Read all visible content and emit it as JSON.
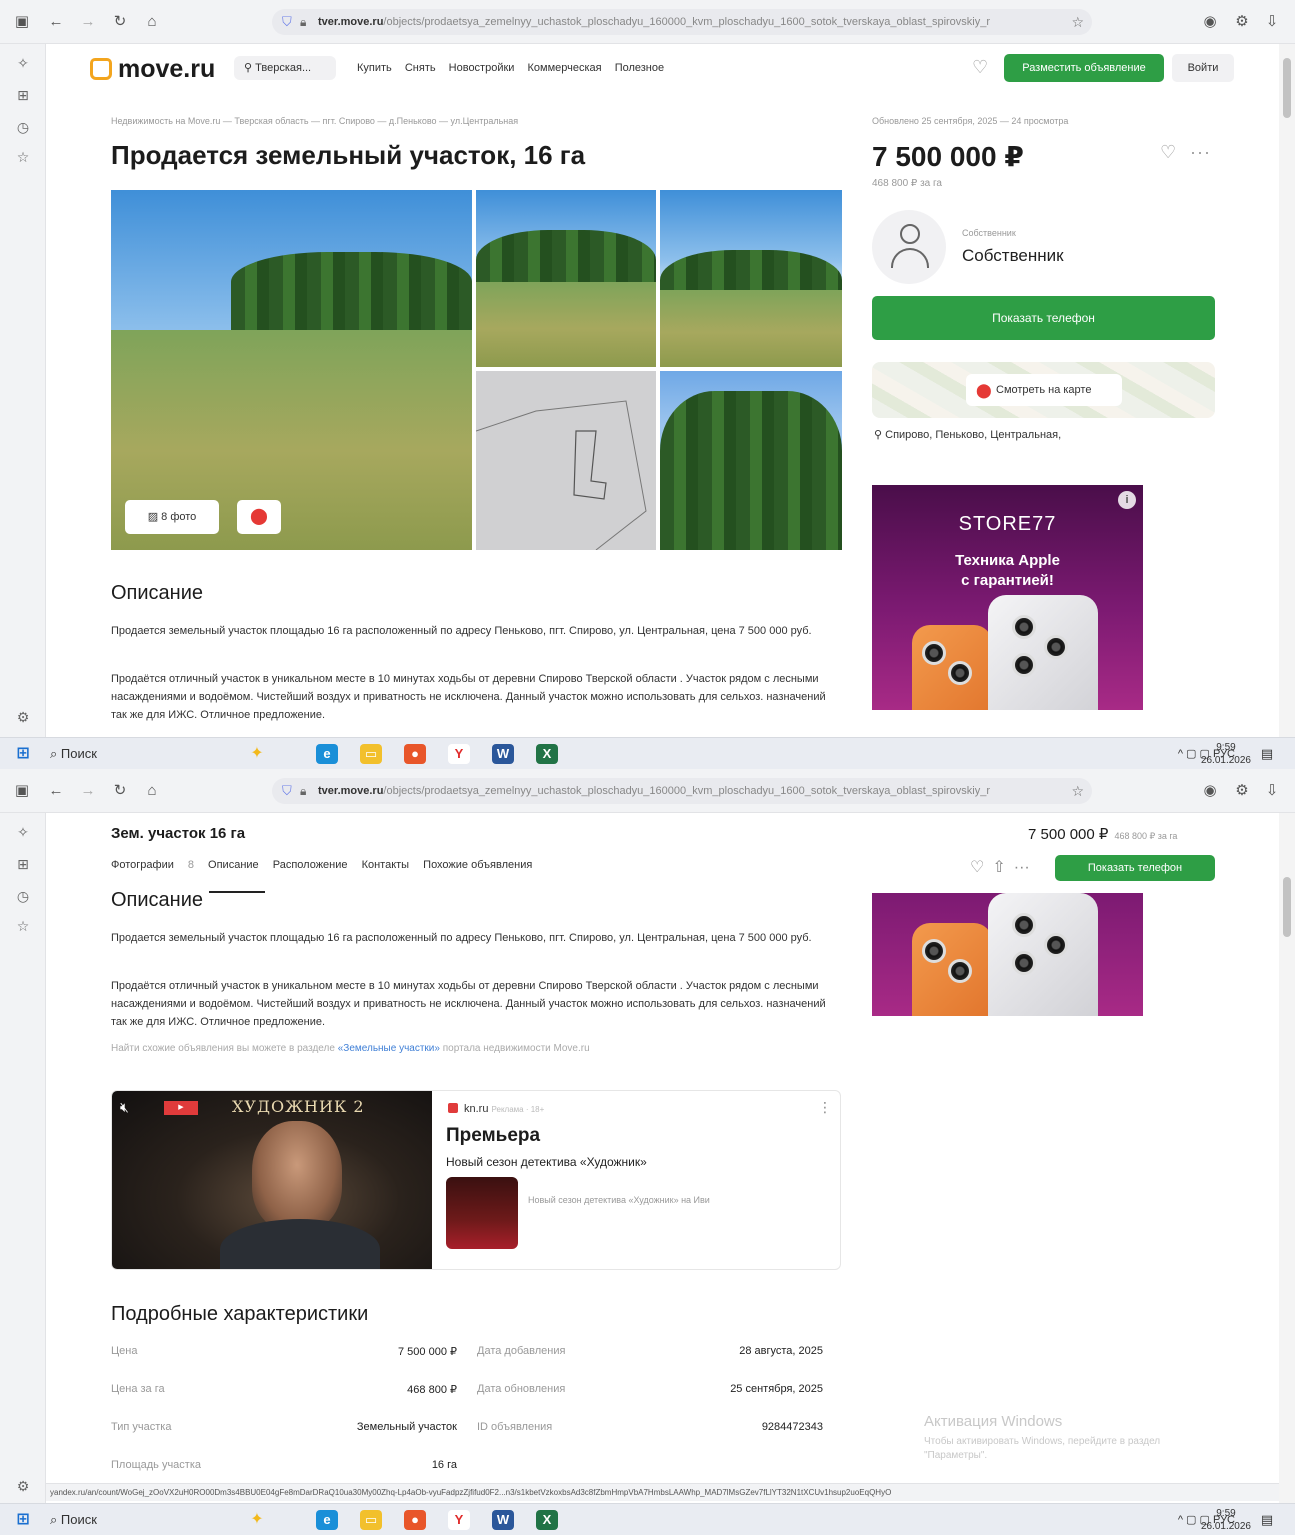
{
  "browser": {
    "url_host": "tver.move.ru",
    "url_path": "/objects/prodaetsya_zemelnyy_uchastok_ploschadyu_160000_kvm_ploschadyu_1600_sotok_tverskaya_oblast_spirovskiy_r"
  },
  "taskbar": {
    "search_label": "Поиск",
    "lang": "РУС",
    "time": "9:59",
    "date": "26.01.2026"
  },
  "header": {
    "logo": "move.ru",
    "region": "Тверская...",
    "nav": [
      "Купить",
      "Снять",
      "Новостройки",
      "Коммерческая",
      "Полезное"
    ],
    "post_button": "Разместить объявление",
    "login_button": "Войти"
  },
  "breadcrumbs": "Недвижимость на Move.ru — Тверская область — пгт. Спирово — д.Пеньково — ул.Центральная",
  "published": "Обновлено 25 сентября, 2025 — 24 просмотра",
  "title": "Продается земельный участок, 16 га",
  "gallery": {
    "photos_button": "8 фото"
  },
  "price": {
    "main": "7 500 000 ₽",
    "per_ha": "468 800 ₽ за га"
  },
  "seller": {
    "caption": "Собственник",
    "name": "Собственник"
  },
  "phone_button": "Показать телефон",
  "map": {
    "button": "Смотреть на карте",
    "address": "Спирово, Пеньково, Центральная,"
  },
  "ad": {
    "brand": "STORE77",
    "tagline_1": "Техника Apple",
    "tagline_2": "с гарантией!"
  },
  "description": {
    "title": "Описание",
    "p1": "Продается земельный участок площадью 16 га расположенный по адресу Пеньково, пгт. Спирово, ул. Центральная, цена 7 500 000 руб.",
    "p2": "Продаётся отличный участок в уникальном месте в 10 минутах ходьбы от деревни Спирово Тверской области . Участок рядом с лесными насаждениями и водоёмом. Чистейший воздух и приватность не исключена. Данный участок можно использовать для сельхоз. назначений так же для ИЖС. Отличное предложение.",
    "link_prefix": "Найти схожие объявления вы можете в разделе",
    "link_text": "«Земельные участки»",
    "link_suffix": "портала недвижимости Move.ru"
  },
  "sticky": {
    "title": "Зем. участок 16 га",
    "price": "7 500 000 ₽",
    "per_ha": "468 800 ₽ за га",
    "tabs": [
      "Фотографии",
      "Описание",
      "Расположение",
      "Контакты",
      "Похожие объявления"
    ],
    "photo_count": "8"
  },
  "video_ad": {
    "source": "kn.ru",
    "source_note": "Реклама · 18+",
    "video_title": "ХУДОЖНИК 2",
    "headline": "Премьера",
    "subtitle": "Новый сезон детектива «Художник»",
    "thumb_text": "Новый сезон детектива «Художник» на Иви"
  },
  "characteristics": {
    "title": "Подробные характеристики",
    "rows": [
      {
        "l": "Цена",
        "v": "7 500 000 ₽",
        "l2": "Дата добавления",
        "v2": "28 августа, 2025"
      },
      {
        "l": "Цена за га",
        "v": "468 800 ₽",
        "l2": "Дата обновления",
        "v2": "25 сентября, 2025"
      },
      {
        "l": "Тип участка",
        "v": "Земельный участок",
        "l2": "ID объявления",
        "v2": "9284472343"
      },
      {
        "l": "Площадь участка",
        "v": "16 га",
        "l2": "",
        "v2": ""
      }
    ]
  },
  "windows": {
    "activate_title": "Активация Windows",
    "activate_text_1": "Чтобы активировать Windows, перейдите в раздел",
    "activate_text_2": "\"Параметры\"."
  },
  "statusbar": "yandex.ru/an/count/WoGej_zOoVX2uH0RO00Dm3s4BBU0E04gFe8mDarDRaQ10ua30My00Zhq-Lp4aOb-vyuFadpzZjfifud0F2...n3/s1kbetVzkoxbsAd3c8fZbmHmpVbA7HmbsLAAWhp_MAD7lMsGZev7fLlYT32N1tXCUv1hsup2uoEqQHyO"
}
